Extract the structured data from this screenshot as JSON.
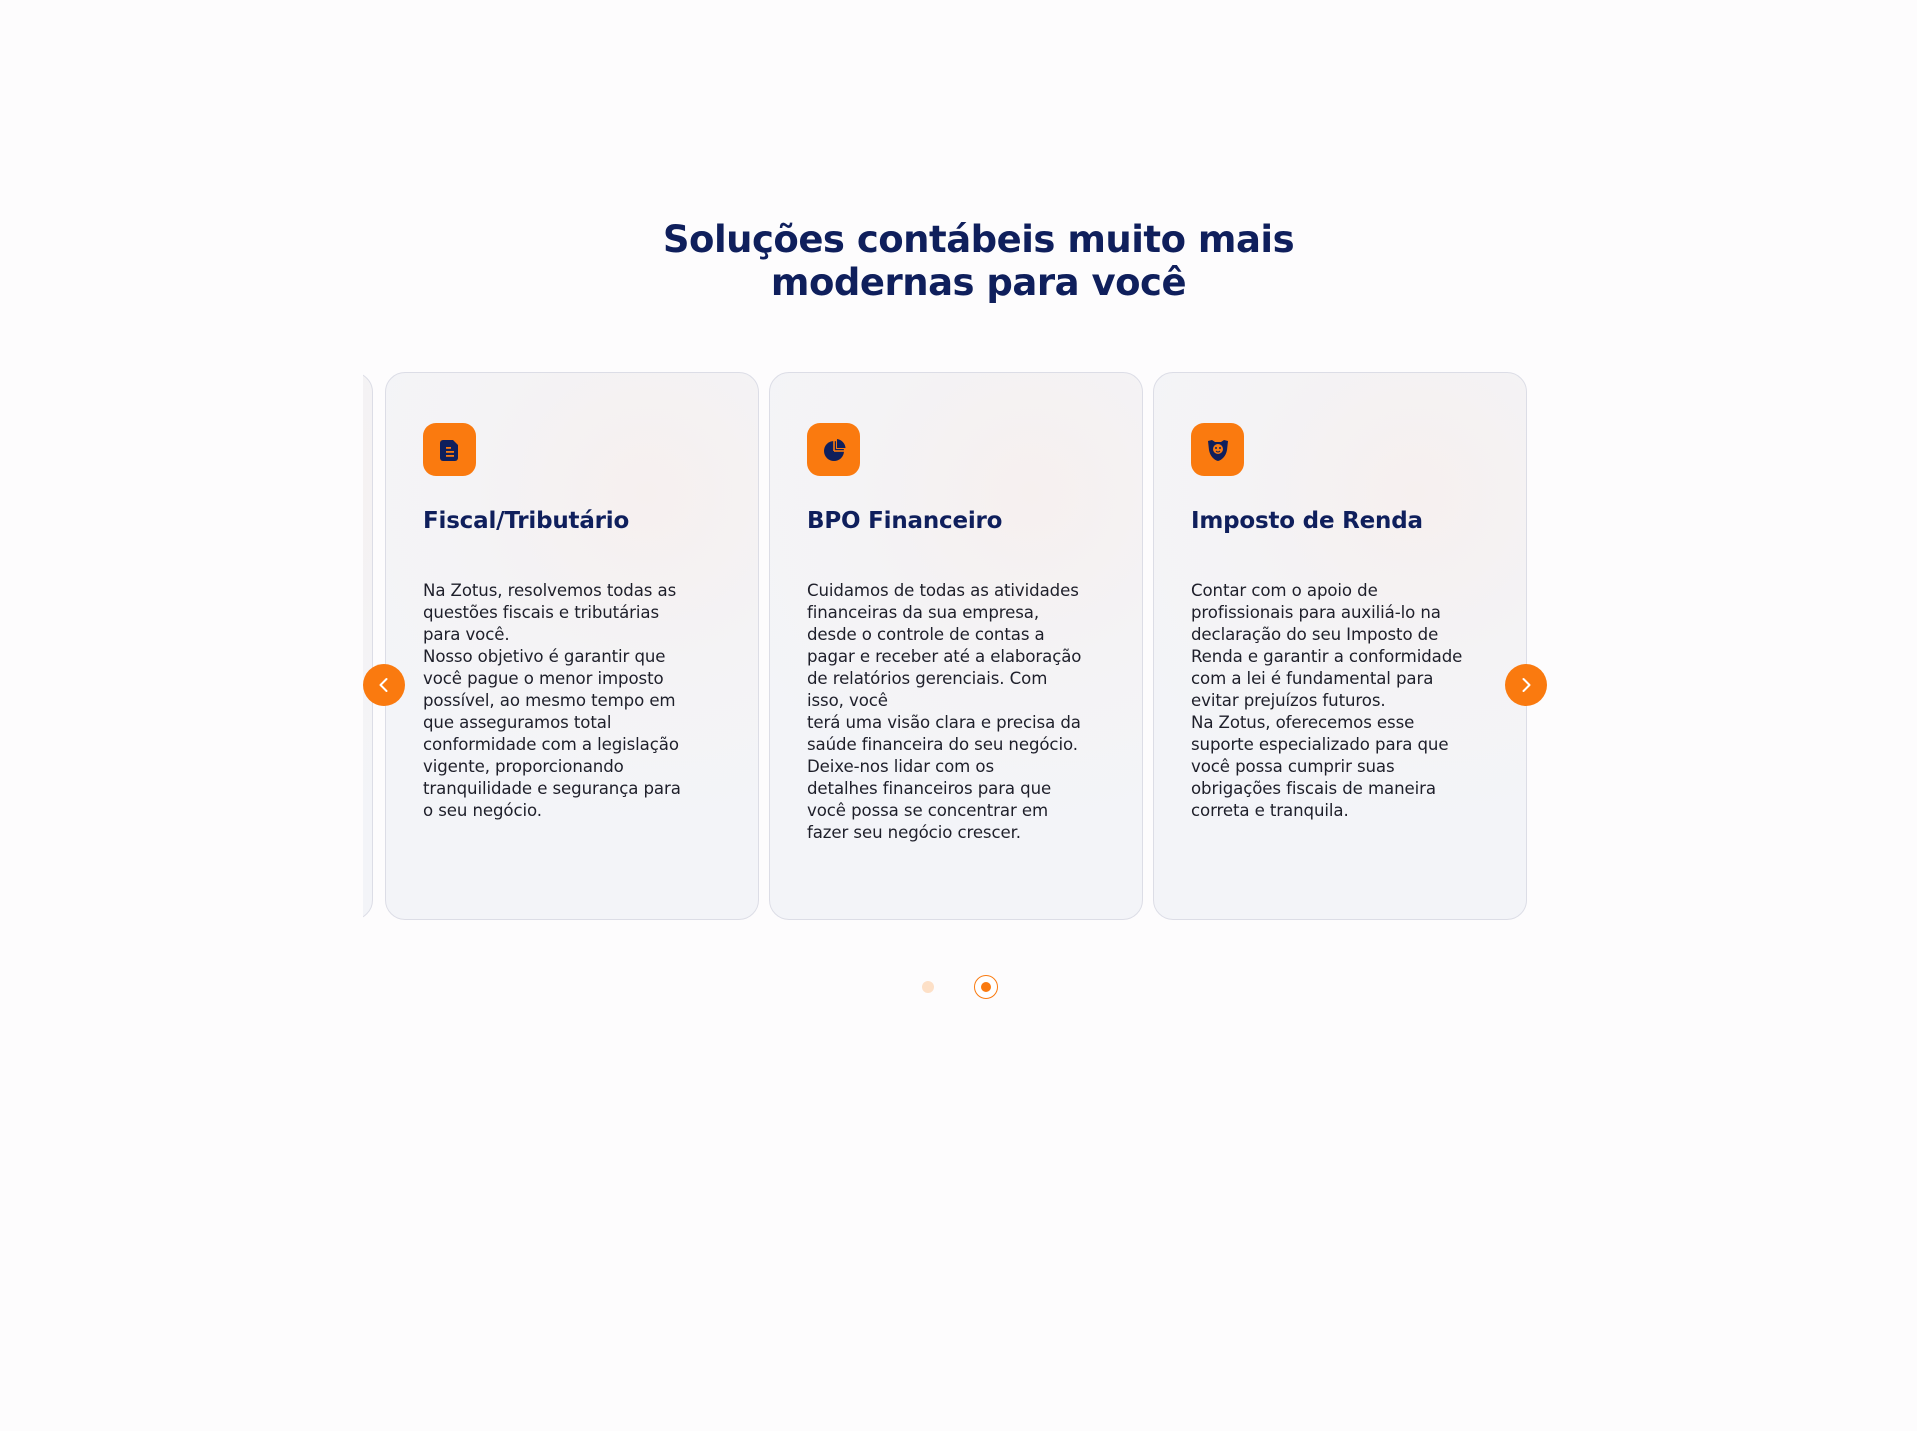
{
  "section": {
    "title_line1": "Soluções contábeis muito mais",
    "title_line2": "modernas para você"
  },
  "cards": [
    {
      "icon": "document-icon",
      "title": "Fiscal/Tributário",
      "body": "Na Zotus, resolvemos todas as\nquestões fiscais e tributárias\npara você.\nNosso objetivo é garantir que\nvocê pague o menor imposto\npossível, ao mesmo tempo em\nque   asseguramos total\nconformidade com a legislação\nvigente, proporcionando\ntranquilidade e   segurança para\no seu negócio."
    },
    {
      "icon": "pie-chart-icon",
      "title": "BPO Financeiro",
      "body": "Cuidamos de todas as atividades\nfinanceiras da sua empresa,\ndesde o   controle de contas a\npagar e receber até a elaboração\nde relatórios gerenciais. Com\nisso, você\nterá uma visão clara e precisa da\nsaúde financeira do seu negócio.\nDeixe-nos lidar com os\ndetalhes financeiros para que\nvocê possa se concentrar em\nfazer seu negócio crescer."
    },
    {
      "icon": "lion-shield-icon",
      "title": "Imposto de Renda",
      "body": "Contar com o apoio de\nprofissionais para auxiliá-lo na\ndeclaração do seu   Imposto de\nRenda e garantir a conformidade\ncom a lei é fundamental para\nevitar prejuízos   futuros.\nNa Zotus, oferecemos esse\nsuporte especializado para que\nvocê possa cumprir suas\nobrigações fiscais de maneira\ncorreta e tranquila."
    }
  ],
  "carousel": {
    "prev_icon": "chevron-left-icon",
    "next_icon": "chevron-right-icon",
    "page_count": 2,
    "active_page": 2
  },
  "colors": {
    "accent": "#fa7a0f",
    "heading": "#0f1f5c",
    "text": "#1e1f2a",
    "background": "#fdfcfd"
  }
}
